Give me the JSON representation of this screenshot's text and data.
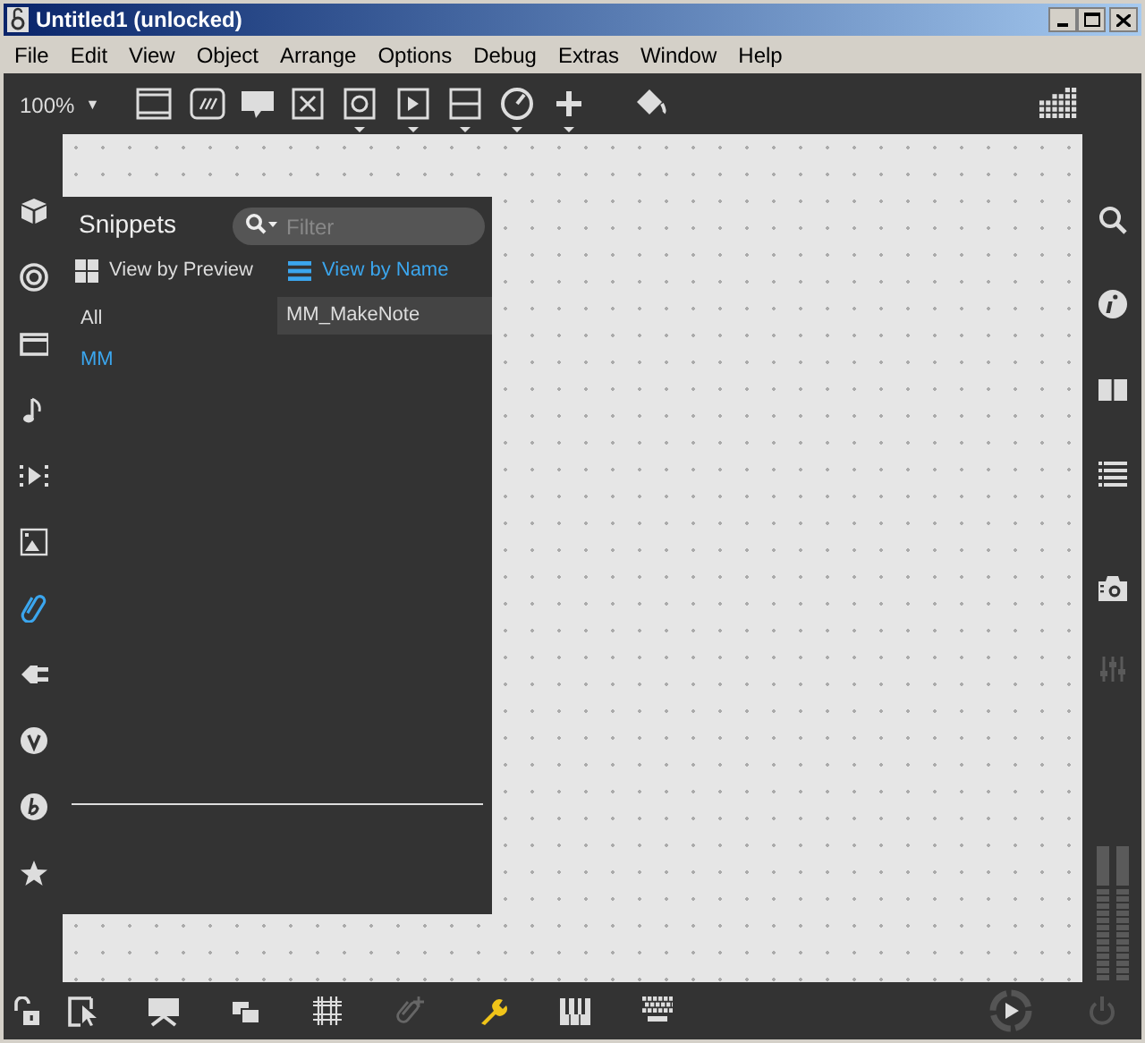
{
  "window": {
    "title": "Untitled1 (unlocked)"
  },
  "menu": [
    "File",
    "Edit",
    "View",
    "Object",
    "Arrange",
    "Options",
    "Debug",
    "Extras",
    "Window",
    "Help"
  ],
  "toolbar": {
    "zoom": "100%",
    "zoom_caret": "▼"
  },
  "left_sidebar": [
    {
      "selected": false
    },
    {
      "selected": false
    },
    {
      "selected": false
    },
    {
      "selected": false
    },
    {
      "selected": false
    },
    {
      "selected": false
    },
    {
      "selected": true
    },
    {
      "selected": false
    },
    {
      "selected": false
    },
    {
      "selected": false
    },
    {
      "selected": false
    }
  ],
  "snippets": {
    "title": "Snippets",
    "filter": {
      "placeholder": "Filter"
    },
    "views": [
      {
        "label": "View by Preview",
        "selected": false
      },
      {
        "label": "View by Name",
        "selected": true
      }
    ],
    "categories": [
      {
        "label": "All",
        "selected": false
      },
      {
        "label": "MM",
        "selected": true
      }
    ],
    "items": [
      {
        "label": "MM_MakeNote",
        "selected": true
      }
    ]
  },
  "right_sidebar": [
    {
      "disabled": false
    },
    {
      "disabled": false
    },
    {
      "disabled": false
    },
    {
      "disabled": false
    },
    {
      "disabled": false
    },
    {
      "disabled": true
    }
  ],
  "bottom_toolbar": [
    {
      "disabled": false
    },
    {
      "disabled": false
    },
    {
      "disabled": false
    },
    {
      "disabled": false
    },
    {
      "disabled": false
    },
    {
      "disabled": true
    },
    {
      "selected": true
    },
    {
      "disabled": false
    },
    {
      "disabled": false
    }
  ]
}
